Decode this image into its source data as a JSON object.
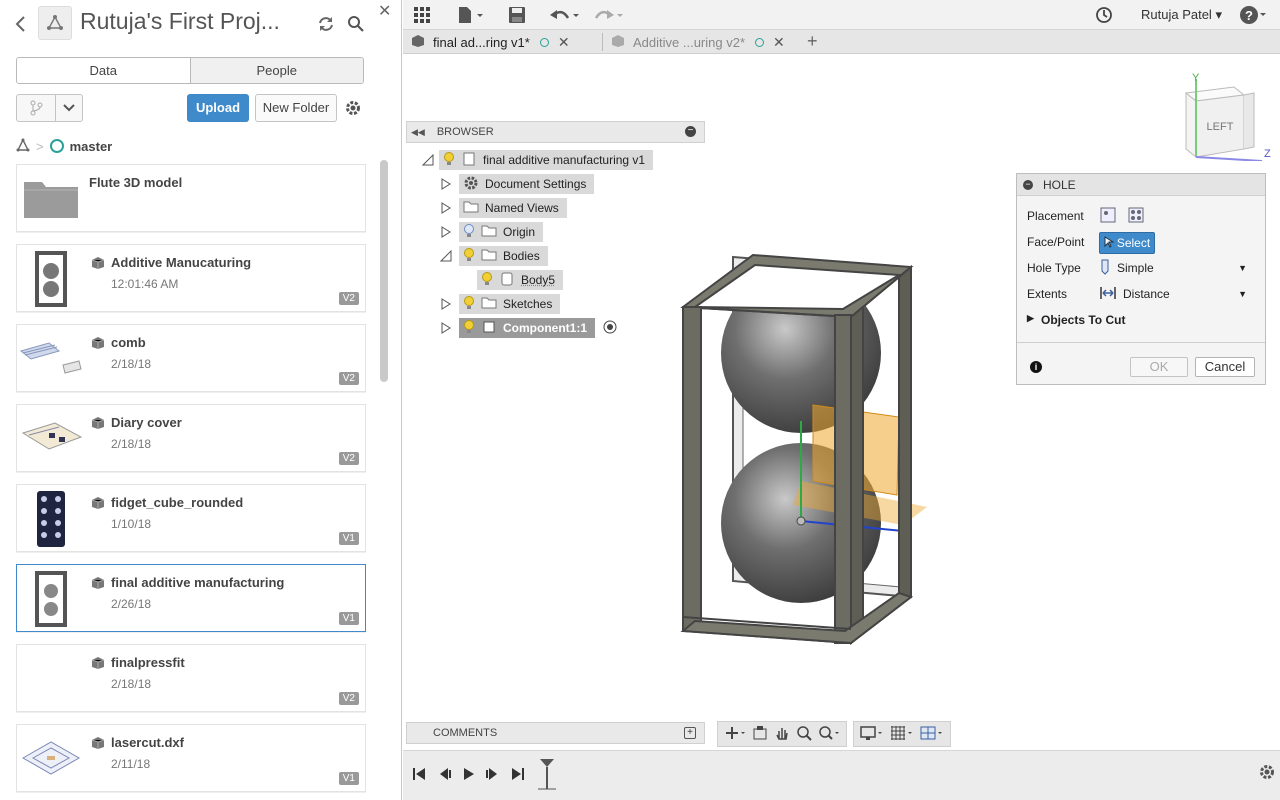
{
  "data_panel": {
    "project_title": "Rutuja's First Proj...",
    "tabs": [
      "Data",
      "People"
    ],
    "upload_label": "Upload",
    "new_folder_label": "New Folder",
    "breadcrumb": "master",
    "files": [
      {
        "name": "Flute 3D model",
        "date": "",
        "version": "",
        "kind": "folder"
      },
      {
        "name": "Additive Manucaturing",
        "date": "12:01:46 AM",
        "version": "V2",
        "kind": "design"
      },
      {
        "name": "comb",
        "date": "2/18/18",
        "version": "V2",
        "kind": "design"
      },
      {
        "name": "Diary cover",
        "date": "2/18/18",
        "version": "V2",
        "kind": "design"
      },
      {
        "name": "fidget_cube_rounded",
        "date": "1/10/18",
        "version": "V1",
        "kind": "design"
      },
      {
        "name": "final additive manufacturing",
        "date": "2/26/18",
        "version": "V1",
        "kind": "design"
      },
      {
        "name": "finalpressfit",
        "date": "2/18/18",
        "version": "V2",
        "kind": "design"
      },
      {
        "name": "lasercut.dxf",
        "date": "2/11/18",
        "version": "V1",
        "kind": "design"
      }
    ]
  },
  "app_bar": {
    "user_name": "Rutuja Patel"
  },
  "doc_tabs": [
    {
      "label": "final ad...ring v1*",
      "active": true
    },
    {
      "label": "Additive ...uring v2*",
      "active": false
    }
  ],
  "browser": {
    "header": "BROWSER",
    "items": [
      {
        "label": "final additive manufacturing v1"
      },
      {
        "label": "Document Settings"
      },
      {
        "label": "Named Views"
      },
      {
        "label": "Origin"
      },
      {
        "label": "Bodies"
      },
      {
        "label": "Body5"
      },
      {
        "label": "Sketches"
      },
      {
        "label": "Component1:1"
      }
    ]
  },
  "viewcube": {
    "face": "LEFT",
    "axis_y": "Y",
    "axis_z": "Z"
  },
  "hole_dialog": {
    "title": "HOLE",
    "placement_label": "Placement",
    "face_point_label": "Face/Point",
    "select_label": "Select",
    "hole_type_label": "Hole Type",
    "hole_type_value": "Simple",
    "extents_label": "Extents",
    "extents_value": "Distance",
    "objects_to_cut_label": "Objects To Cut",
    "ok_label": "OK",
    "cancel_label": "Cancel"
  },
  "comments": {
    "label": "COMMENTS"
  },
  "colors": {
    "accent": "#3e8acb",
    "branch": "#2aa198",
    "sketch_plane": "#f0a830"
  }
}
